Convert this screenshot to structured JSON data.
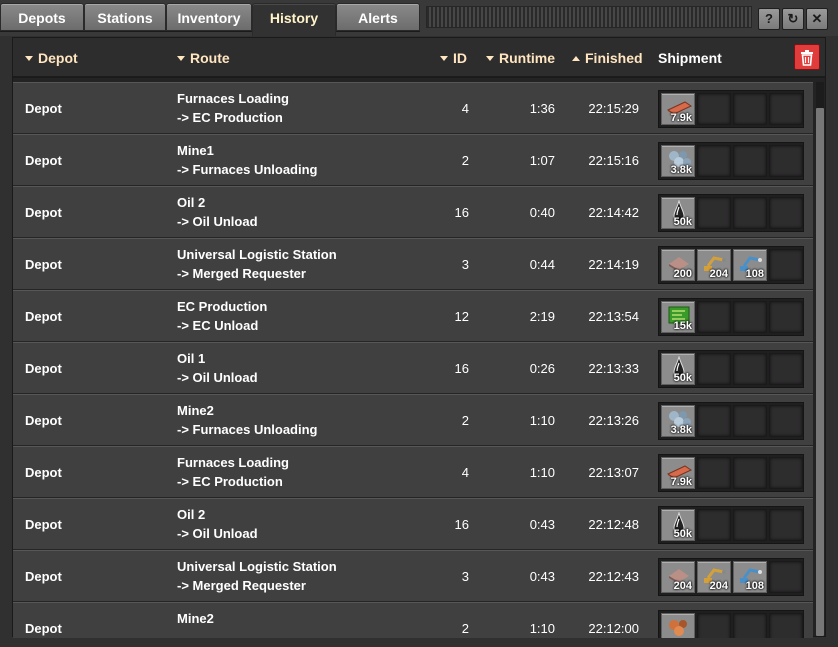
{
  "tabs": [
    {
      "label": "Depots",
      "active": false
    },
    {
      "label": "Stations",
      "active": false
    },
    {
      "label": "Inventory",
      "active": false
    },
    {
      "label": "History",
      "active": true
    },
    {
      "label": "Alerts",
      "active": false
    }
  ],
  "title_buttons": {
    "help_icon": "?",
    "refresh_icon": "↻",
    "close_icon": "✕"
  },
  "columns": {
    "depot": "Depot",
    "route": "Route",
    "id": "ID",
    "runtime": "Runtime",
    "finished": "Finished",
    "shipment": "Shipment"
  },
  "rows": [
    {
      "depot": "Depot",
      "route_from": "Furnaces Loading",
      "route_to": "-> EC Production",
      "id": "4",
      "runtime": "1:36",
      "finished": "22:15:29",
      "shipment": [
        {
          "icon": "copper-plate-icon",
          "qty": "7.9k"
        }
      ]
    },
    {
      "depot": "Depot",
      "route_from": "Mine1",
      "route_to": "-> Furnaces Unloading",
      "id": "2",
      "runtime": "1:07",
      "finished": "22:15:16",
      "shipment": [
        {
          "icon": "iron-ore-icon",
          "qty": "3.8k"
        }
      ]
    },
    {
      "depot": "Depot",
      "route_from": "Oil 2",
      "route_to": "-> Oil Unload",
      "id": "16",
      "runtime": "0:40",
      "finished": "22:14:42",
      "shipment": [
        {
          "icon": "crude-oil-icon",
          "qty": "50k"
        }
      ]
    },
    {
      "depot": "Depot",
      "route_from": "Universal Logistic Station",
      "route_to": "-> Merged Requester",
      "id": "3",
      "runtime": "0:44",
      "finished": "22:14:19",
      "shipment": [
        {
          "icon": "stone-brick-icon",
          "qty": "200"
        },
        {
          "icon": "inserter-icon",
          "qty": "204"
        },
        {
          "icon": "fast-inserter-icon",
          "qty": "108"
        }
      ]
    },
    {
      "depot": "Depot",
      "route_from": "EC Production",
      "route_to": "-> EC Unload",
      "id": "12",
      "runtime": "2:19",
      "finished": "22:13:54",
      "shipment": [
        {
          "icon": "electronic-circuit-icon",
          "qty": "15k"
        }
      ]
    },
    {
      "depot": "Depot",
      "route_from": "Oil 1",
      "route_to": "-> Oil Unload",
      "id": "16",
      "runtime": "0:26",
      "finished": "22:13:33",
      "shipment": [
        {
          "icon": "crude-oil-icon",
          "qty": "50k"
        }
      ]
    },
    {
      "depot": "Depot",
      "route_from": "Mine2",
      "route_to": "-> Furnaces Unloading",
      "id": "2",
      "runtime": "1:10",
      "finished": "22:13:26",
      "shipment": [
        {
          "icon": "iron-ore-icon",
          "qty": "3.8k"
        }
      ]
    },
    {
      "depot": "Depot",
      "route_from": "Furnaces Loading",
      "route_to": "-> EC Production",
      "id": "4",
      "runtime": "1:10",
      "finished": "22:13:07",
      "shipment": [
        {
          "icon": "copper-plate-icon",
          "qty": "7.9k"
        }
      ]
    },
    {
      "depot": "Depot",
      "route_from": "Oil 2",
      "route_to": "-> Oil Unload",
      "id": "16",
      "runtime": "0:43",
      "finished": "22:12:48",
      "shipment": [
        {
          "icon": "crude-oil-icon",
          "qty": "50k"
        }
      ]
    },
    {
      "depot": "Depot",
      "route_from": "Universal Logistic Station",
      "route_to": "-> Merged Requester",
      "id": "3",
      "runtime": "0:43",
      "finished": "22:12:43",
      "shipment": [
        {
          "icon": "stone-brick-icon",
          "qty": "204"
        },
        {
          "icon": "inserter-icon",
          "qty": "204"
        },
        {
          "icon": "fast-inserter-icon",
          "qty": "108"
        }
      ]
    },
    {
      "depot": "Depot",
      "route_from": "Mine2",
      "route_to": "",
      "id": "2",
      "runtime": "1:10",
      "finished": "22:12:00",
      "shipment": [
        {
          "icon": "copper-ore-icon",
          "qty": ""
        }
      ]
    }
  ]
}
